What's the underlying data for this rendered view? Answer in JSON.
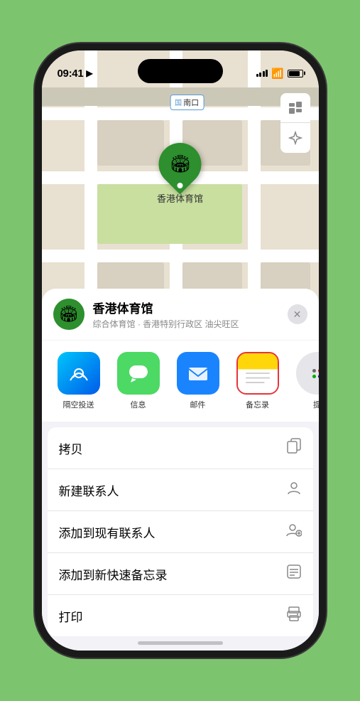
{
  "status_bar": {
    "time": "09:41",
    "location_arrow": "▶"
  },
  "map": {
    "label": "南口",
    "pin_label": "香港体育馆"
  },
  "location_card": {
    "name": "香港体育馆",
    "subtitle": "综合体育馆 · 香港特别行政区 油尖旺区"
  },
  "share_apps": [
    {
      "id": "airdrop",
      "label": "隔空投送",
      "emoji": "📡",
      "bg": "airdrop"
    },
    {
      "id": "messages",
      "label": "信息",
      "emoji": "💬",
      "bg": "message"
    },
    {
      "id": "mail",
      "label": "邮件",
      "emoji": "✉️",
      "bg": "mail"
    },
    {
      "id": "notes",
      "label": "备忘录",
      "emoji": "📋",
      "bg": "notes",
      "selected": true
    },
    {
      "id": "more",
      "label": "提",
      "emoji": "",
      "bg": "more"
    }
  ],
  "actions": [
    {
      "id": "copy",
      "label": "拷贝",
      "icon": "⎘"
    },
    {
      "id": "new-contact",
      "label": "新建联系人",
      "icon": "👤"
    },
    {
      "id": "add-existing",
      "label": "添加到现有联系人",
      "icon": "👥"
    },
    {
      "id": "add-notes",
      "label": "添加到新快速备忘录",
      "icon": "🗒"
    },
    {
      "id": "print",
      "label": "打印",
      "icon": "🖨"
    }
  ]
}
